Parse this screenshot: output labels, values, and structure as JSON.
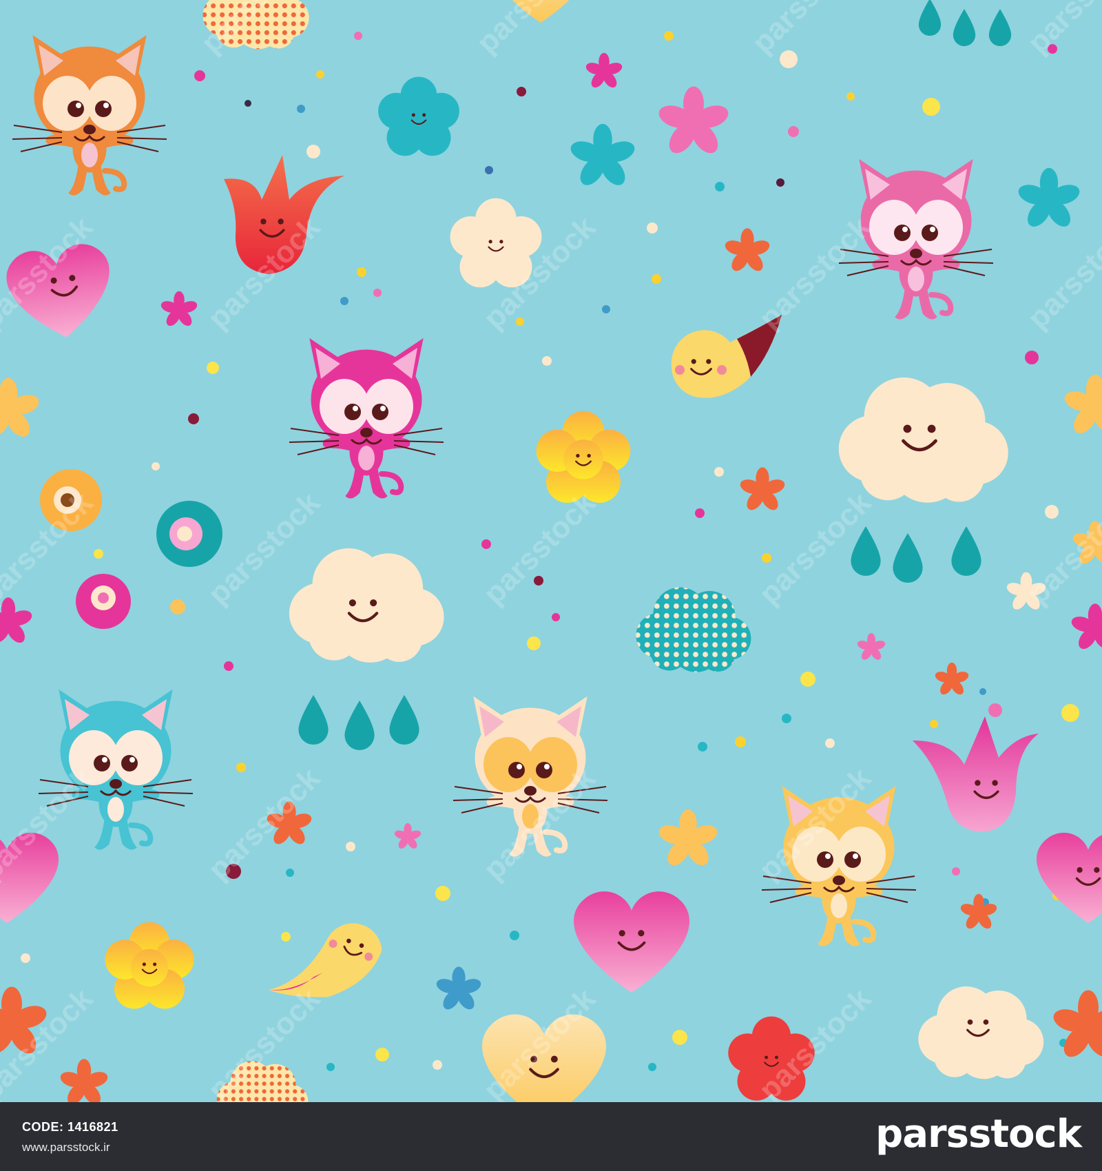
{
  "artwork": {
    "background_color": "#8fd3de",
    "watermark_text": "parsstock",
    "characters": [
      {
        "kind": "kitten",
        "color": "#f08a3c",
        "ear_inner": "#f6c4b8",
        "eye_patch": "#fde3c8"
      },
      {
        "kind": "kitten",
        "color": "#e6359a",
        "ear_inner": "#f7b0d6",
        "eye_patch": "#fde3ea"
      },
      {
        "kind": "kitten",
        "color": "#ea6aa8",
        "ear_inner": "#f8c0dc",
        "eye_patch": "#fde6ef"
      },
      {
        "kind": "kitten",
        "color": "#47c3d3",
        "ear_inner": "#f6c4d0",
        "eye_patch": "#fdeadb"
      },
      {
        "kind": "kitten",
        "color": "#fde3c4",
        "ear_inner": "#f6b8c8",
        "eye_patch": "#fbc35a"
      },
      {
        "kind": "kitten",
        "color": "#fbc75b",
        "ear_inner": "#f6c4d0",
        "eye_patch": "#fde8c6"
      }
    ],
    "palette": {
      "cloud": "#fde8cc",
      "rain": "#17a4a8",
      "pink": "#e6359a",
      "yellow": "#fbd12f",
      "orange": "#f0673c",
      "teal": "#27b7c4",
      "cream": "#fde8cc"
    }
  },
  "footer": {
    "code_text": "CODE: 1416821",
    "site_text": "www.parsstock.ir",
    "brand_text": "parsstock"
  }
}
